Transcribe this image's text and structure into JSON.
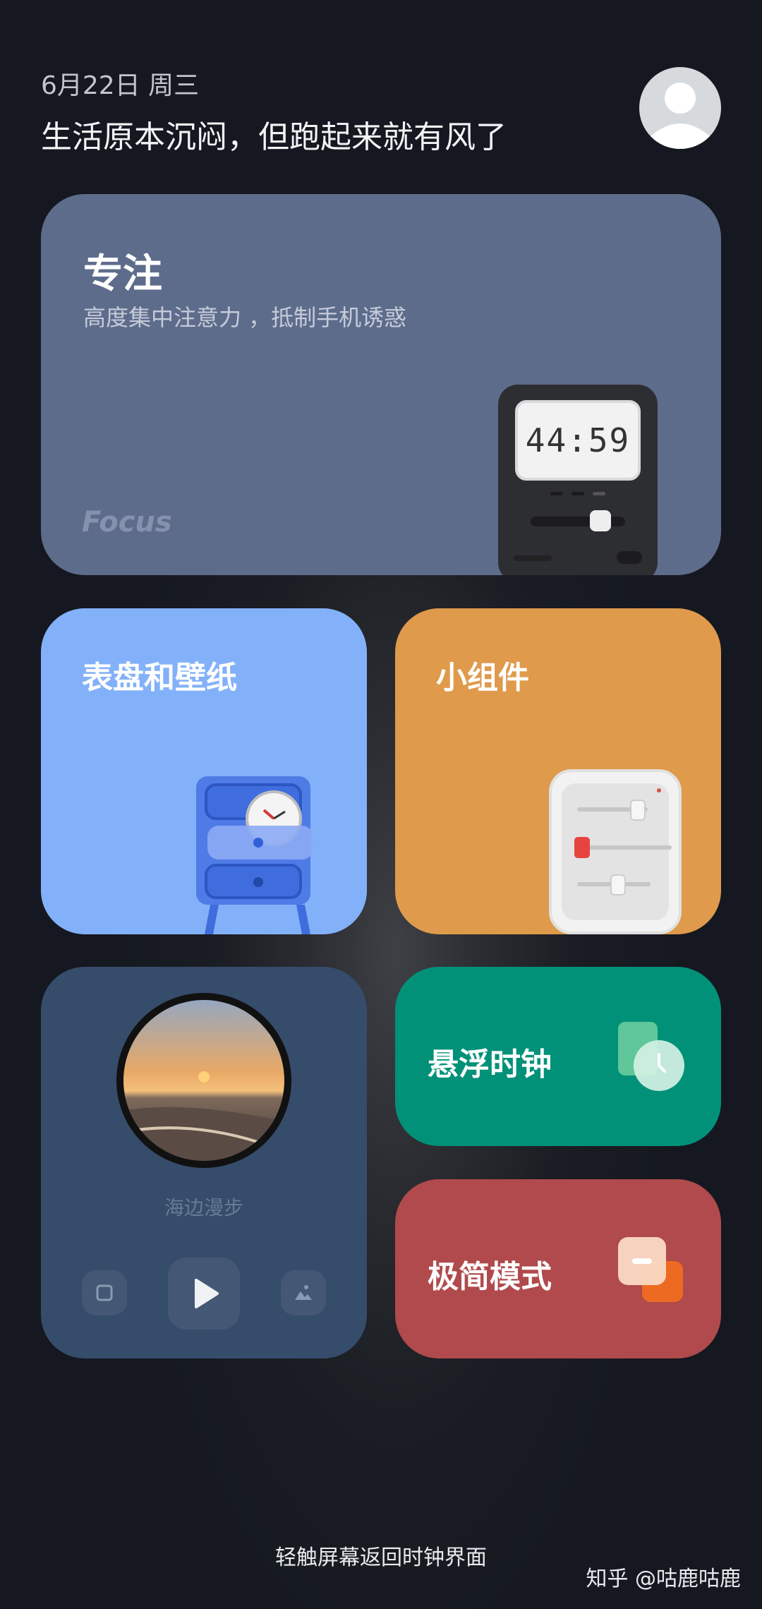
{
  "header": {
    "date": "6月22日 周三",
    "motto": "生活原本沉闷，但跑起来就有风了"
  },
  "focus_card": {
    "title": "专注",
    "subtitle": "高度集中注意力 ，抵制手机诱惑",
    "brand": "Focus",
    "timer": "44:59"
  },
  "watch_card": {
    "title": "表盘和壁纸"
  },
  "widget_card": {
    "title": "小组件"
  },
  "music_card": {
    "track": "海边漫步"
  },
  "float_clock_card": {
    "title": "悬浮时钟"
  },
  "minimal_card": {
    "title": "极简模式"
  },
  "footer": {
    "tip": "轻触屏幕返回时钟界面",
    "watermark": "知乎 @咕鹿咕鹿"
  },
  "colors": {
    "focus": "#5e6c8c",
    "watch": "#83b1f9",
    "widget": "#df9a4b",
    "music": "#364c6b",
    "float_clock": "#019179",
    "minimal": "#b04a4c"
  }
}
